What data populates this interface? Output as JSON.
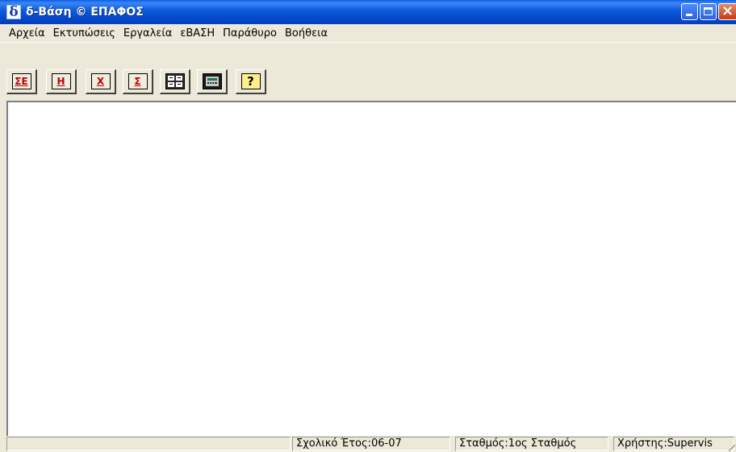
{
  "window": {
    "icon_glyph": "δ",
    "title": "δ-Βάση © ΕΠΑΦΟΣ",
    "buttons": [
      "minimize",
      "maximize",
      "close"
    ]
  },
  "menu": [
    "Αρχεία",
    "Εκτυπώσεις",
    "Εργαλεία",
    "εΒΑΣΗ",
    "Παράθυρο",
    "Βοήθεια"
  ],
  "toolbar": {
    "buttons": [
      {
        "label": "ΣΕ",
        "icon": "se-icon"
      },
      {
        "label": "Η",
        "icon": "h-icon"
      },
      {
        "label": "Χ",
        "icon": "x-icon"
      },
      {
        "label": "Σ",
        "icon": "sigma-icon"
      },
      {
        "label": "",
        "icon": "grid-icon"
      },
      {
        "label": "",
        "icon": "calculator-icon"
      },
      {
        "label": "?",
        "icon": "help-icon"
      }
    ]
  },
  "status": {
    "school_year": "Σχολικό Έτος:06-07",
    "station": "Σταθμός:1ος Σταθμός",
    "user": "Χρήστης:Supervis"
  }
}
